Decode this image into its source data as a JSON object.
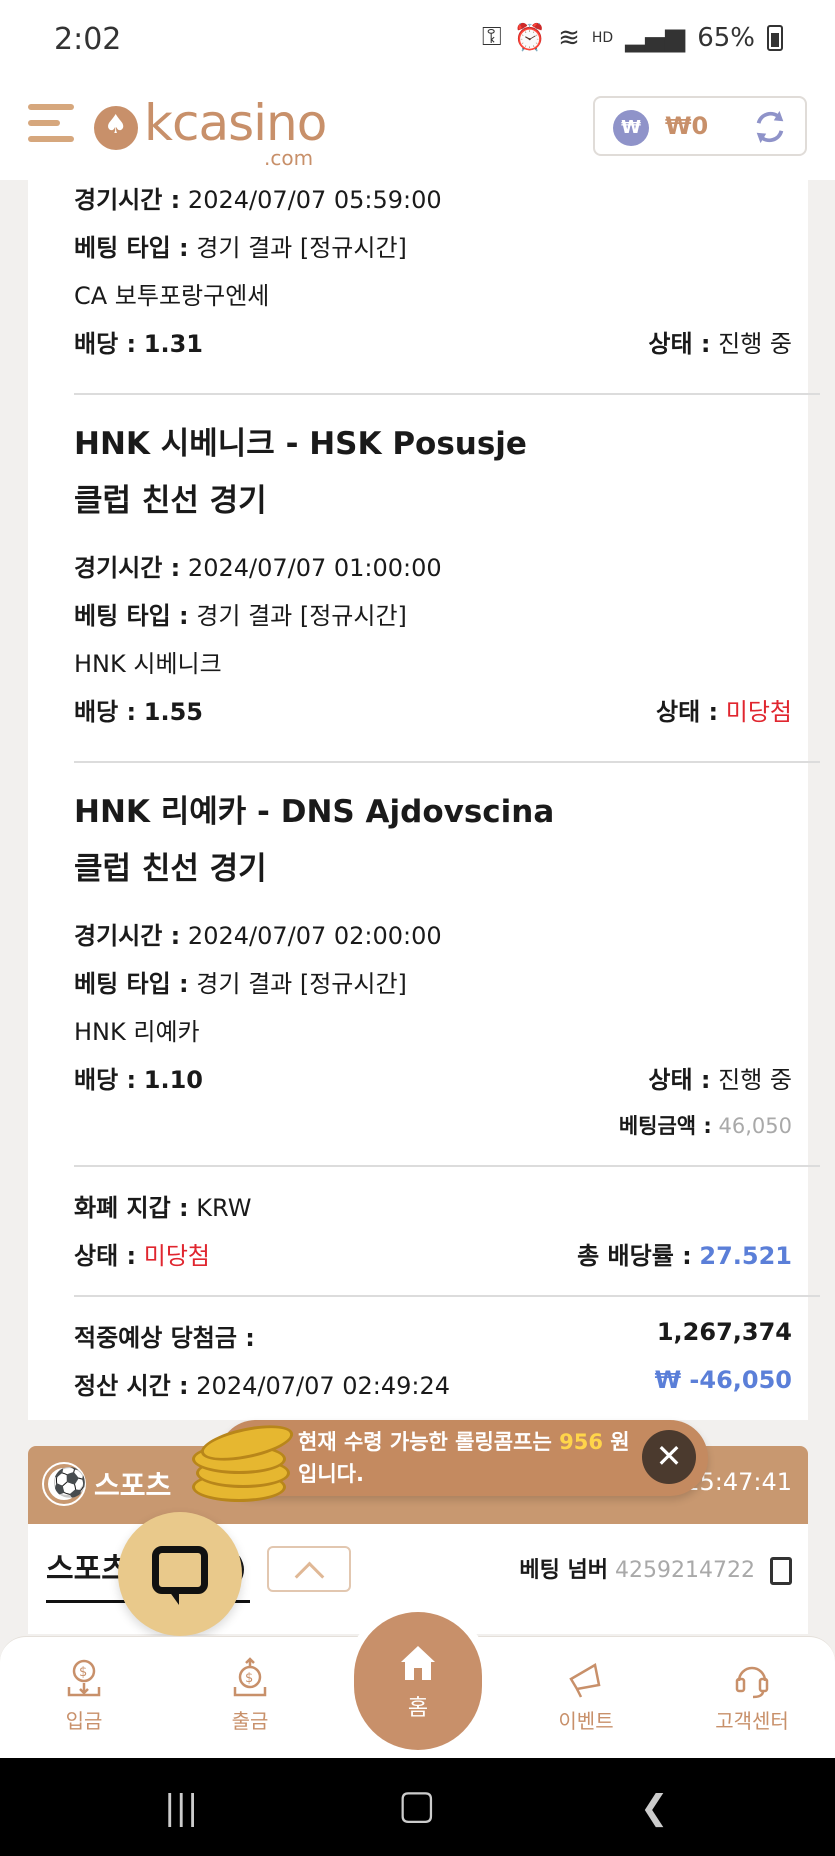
{
  "status_bar": {
    "time": "2:02",
    "hd": "HD",
    "battery": "65%"
  },
  "header": {
    "logo_main": "kcasino",
    "logo_sub": ".com",
    "balance": "₩0",
    "currency_symbol": "₩"
  },
  "bets": [
    {
      "game_time_label": "경기시간 :",
      "game_time": "2024/07/07 05:59:00",
      "bet_type_label": "베팅 타입 :",
      "bet_type": "경기 결과 [정규시간]",
      "pick": "CA 보투포랑구엔세",
      "odds_label": "배당 :",
      "odds": "1.31",
      "status_label": "상태 :",
      "status": "진행 중"
    },
    {
      "match_title": "HNK 시베니크 - HSK Posusje",
      "league": "클럽 친선 경기",
      "game_time_label": "경기시간 :",
      "game_time": "2024/07/07 01:00:00",
      "bet_type_label": "베팅 타입 :",
      "bet_type": "경기 결과 [정규시간]",
      "pick": "HNK 시베니크",
      "odds_label": "배당 :",
      "odds": "1.55",
      "status_label": "상태 :",
      "status": "미당첨"
    },
    {
      "match_title": "HNK 리예카 - DNS Ajdovscina",
      "league": "클럽 친선 경기",
      "game_time_label": "경기시간 :",
      "game_time": "2024/07/07 02:00:00",
      "bet_type_label": "베팅 타입 :",
      "bet_type": "경기 결과 [정규시간]",
      "pick": "HNK 리예카",
      "odds_label": "배당 :",
      "odds": "1.10",
      "status_label": "상태 :",
      "status": "진행 중",
      "bet_amount_label": "베팅금액 :",
      "bet_amount": "46,050"
    }
  ],
  "summary": {
    "currency_label": "화폐 지갑 :",
    "currency": "KRW",
    "status_label": "상태 :",
    "status": "미당첨",
    "total_odds_label": "총 배당률 :",
    "total_odds": "27.521",
    "expected_win_label": "적중예상 당첨금 :",
    "expected_win": "1,267,374",
    "settle_time_label": "정산 시간 :",
    "settle_time": "2024/07/07 02:49:24",
    "settle_amount": "₩ -46,050"
  },
  "sports_bar": {
    "label": "스포츠",
    "time": "5 15:47:41"
  },
  "tab_row": {
    "tab_label": "스포츠",
    "tab_suffix": ")",
    "bet_number_label": "베팅 넘버",
    "bet_number": "4259214722"
  },
  "popup": {
    "msg_before": "현재 수령 가능한 롤링콤프는 ",
    "msg_highlight": "956",
    "msg_after": " 원 입니다.",
    "close": "✕"
  },
  "bottom_nav": {
    "deposit": "입금",
    "withdraw": "출금",
    "home": "홈",
    "event": "이벤트",
    "support": "고객센터"
  },
  "colors": {
    "brand": "#c8906a",
    "loss_red": "#e0262f",
    "odds_blue": "#5b7fd8"
  }
}
